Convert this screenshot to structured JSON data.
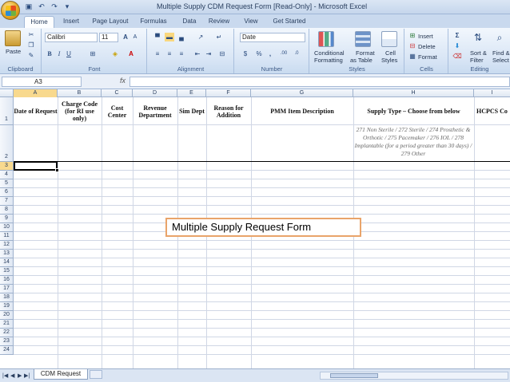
{
  "window": {
    "title": "Multiple Supply CDM Request Form  [Read-Only] - Microsoft Excel"
  },
  "ribbon_tabs": [
    "Home",
    "Insert",
    "Page Layout",
    "Formulas",
    "Data",
    "Review",
    "View",
    "Get Started"
  ],
  "ribbon": {
    "clipboard": {
      "label": "Clipboard",
      "paste": "Paste"
    },
    "font": {
      "label": "Font",
      "name": "Calibri",
      "size": "11"
    },
    "alignment": {
      "label": "Alignment"
    },
    "number": {
      "label": "Number",
      "format": "Date"
    },
    "styles": {
      "label": "Styles",
      "conditional": "Conditional",
      "conditional2": "Formatting",
      "format_as": "Format",
      "format_as2": "as Table",
      "cell": "Cell",
      "cell2": "Styles"
    },
    "cells": {
      "label": "Cells",
      "insert": "Insert",
      "delete": "Delete",
      "format": "Format"
    },
    "editing": {
      "label": "Editing",
      "sort": "Sort &",
      "sort2": "Filter",
      "find": "Find &",
      "find2": "Select"
    }
  },
  "formula_bar": {
    "name_box": "A3",
    "fx": "fx",
    "value": ""
  },
  "columns": [
    "A",
    "B",
    "C",
    "D",
    "E",
    "F",
    "G",
    "H",
    "I"
  ],
  "header_row": [
    "Date of Request",
    "Charge Code (for RI use only)",
    "Cost Center",
    "Revenue Department",
    "Sim Dept",
    "Reason for Addition",
    "PMM Item Description",
    "Supply Type – Choose from below",
    "HCPCS Co"
  ],
  "row2_note": "271 Non Sterile / 272 Sterile / 274 Prosthetic & Orthotic / 275 Pacemaker / 276 IOL / 278 Implantable (for a period greater than 30 days) / 279 Other",
  "row_numbers": [
    "1",
    "2",
    "3",
    "4",
    "5",
    "6",
    "7",
    "8",
    "9",
    "10",
    "11",
    "12",
    "13",
    "14",
    "15",
    "16",
    "17",
    "18",
    "19",
    "20",
    "21",
    "22",
    "23",
    "24"
  ],
  "callout": "Multiple Supply Request Form",
  "sheet_tabs": [
    "CDM Request"
  ]
}
